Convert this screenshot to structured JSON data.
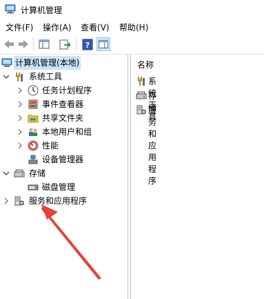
{
  "window": {
    "title": "计算机管理"
  },
  "menu": [
    {
      "label": "文件(F)"
    },
    {
      "label": "操作(A)"
    },
    {
      "label": "查看(V)"
    },
    {
      "label": "帮助(H)"
    }
  ],
  "tree": {
    "root": "计算机管理(本地)",
    "system_tools": "系统工具",
    "task_scheduler": "任务计划程序",
    "event_viewer": "事件查看器",
    "shared_folders": "共享文件夹",
    "local_users": "本地用户和组",
    "performance": "性能",
    "device_manager": "设备管理器",
    "storage": "存储",
    "disk_management": "磁盘管理",
    "services_apps": "服务和应用程序"
  },
  "right_pane": {
    "column_header": "名称",
    "items": [
      {
        "label": "系统工具"
      },
      {
        "label": "存储"
      },
      {
        "label": "服务和应用程序"
      }
    ]
  },
  "colors": {
    "selection": "#cce4f7",
    "annotation_arrow": "#e8403a"
  }
}
